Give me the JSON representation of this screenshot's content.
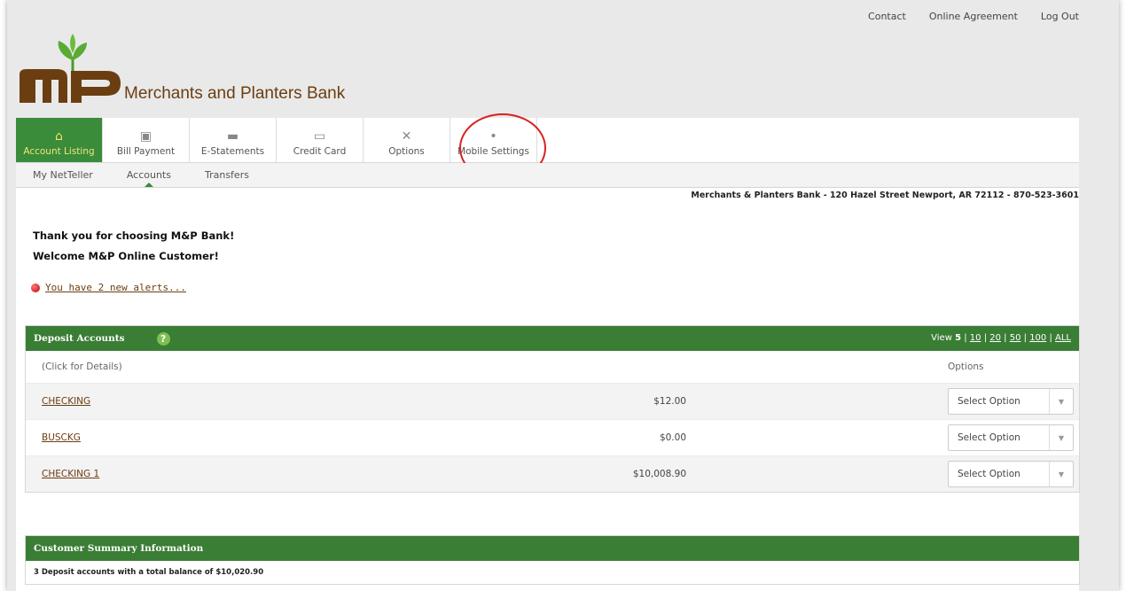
{
  "top_links": {
    "contact": "Contact",
    "agreement": "Online Agreement",
    "logout": "Log Out"
  },
  "brand": {
    "logo_text": "MP",
    "name": "Merchants and Planters Bank"
  },
  "nav": [
    {
      "label": "Account Listing",
      "icon": "home-icon",
      "glyph": "⌂"
    },
    {
      "label": "Bill Payment",
      "icon": "bill-icon",
      "glyph": "▣"
    },
    {
      "label": "E-Statements",
      "icon": "briefcase-icon",
      "glyph": "▬"
    },
    {
      "label": "Credit Card",
      "icon": "credit-card-icon",
      "glyph": "▭"
    },
    {
      "label": "Options",
      "icon": "tools-icon",
      "glyph": "✕"
    },
    {
      "label": "Mobile Settings",
      "icon": "pin-icon",
      "glyph": "•"
    }
  ],
  "subnav": [
    "My NetTeller",
    "Accounts",
    "Transfers"
  ],
  "address": "Merchants & Planters Bank - 120 Hazel Street Newport, AR 72112 - 870-523-3601",
  "welcome": {
    "line1": "Thank you for choosing M&P Bank!",
    "line2": "Welcome M&P Online Customer!",
    "alerts": "You have 2 new alerts..."
  },
  "deposit": {
    "title": "Deposit Accounts",
    "help": "?",
    "view_prefix": "View",
    "view_current": "5",
    "view_options": [
      "10",
      "20",
      "50",
      "100",
      "ALL"
    ],
    "click_hint": "(Click for Details)",
    "options_header": "Options",
    "select_placeholder": "Select Option",
    "rows": [
      {
        "name": "CHECKING",
        "amount": "$12.00"
      },
      {
        "name": "BUSCKG",
        "amount": "$0.00"
      },
      {
        "name": "CHECKING 1",
        "amount": "$10,008.90"
      }
    ]
  },
  "summary": {
    "title": "Customer Summary Information",
    "line": "3 Deposit accounts with a total balance of $10,020.90"
  },
  "colors": {
    "brand_green": "#3a7d34",
    "brand_brown": "#6b3e12",
    "annotation_red": "#d92020"
  }
}
